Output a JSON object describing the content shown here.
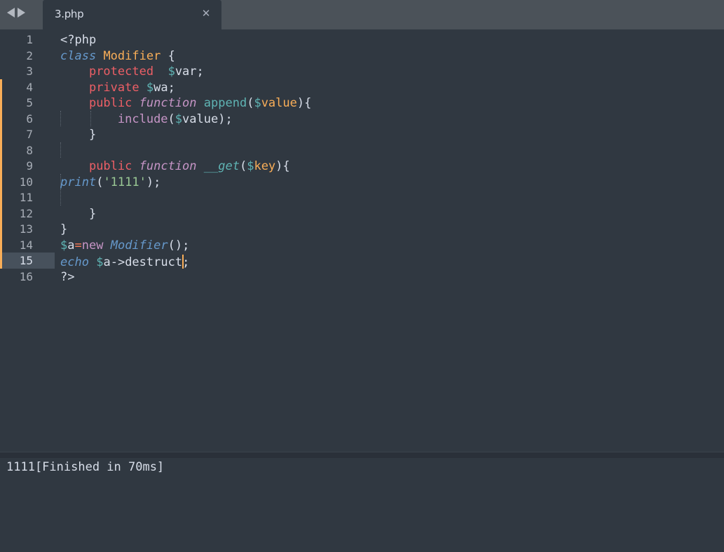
{
  "tab": {
    "title": "3.php",
    "close_icon": "close-icon"
  },
  "nav": {
    "back_icon": "triangle-left-icon",
    "forward_icon": "triangle-right-icon"
  },
  "editor": {
    "current_line": 15,
    "modified_lines": [
      4,
      5,
      6,
      7,
      8,
      9,
      10,
      11,
      12,
      13,
      14,
      15
    ],
    "lines": [
      {
        "num": "1",
        "tokens": [
          {
            "t": "<?php",
            "c": "plain"
          }
        ]
      },
      {
        "num": "2",
        "tokens": [
          {
            "t": "class",
            "c": "stor"
          },
          {
            "t": " ",
            "c": "plain"
          },
          {
            "t": "Modifier",
            "c": "cls"
          },
          {
            "t": " {",
            "c": "plain"
          }
        ]
      },
      {
        "num": "3",
        "tokens": [
          {
            "t": "    ",
            "c": "plain"
          },
          {
            "t": "protected",
            "c": "mod"
          },
          {
            "t": "  ",
            "c": "plain"
          },
          {
            "t": "$",
            "c": "var-d"
          },
          {
            "t": "var",
            "c": "var"
          },
          {
            "t": ";",
            "c": "plain"
          }
        ]
      },
      {
        "num": "4",
        "tokens": [
          {
            "t": "    ",
            "c": "plain"
          },
          {
            "t": "private",
            "c": "mod"
          },
          {
            "t": " ",
            "c": "plain"
          },
          {
            "t": "$",
            "c": "var-d"
          },
          {
            "t": "wa",
            "c": "var"
          },
          {
            "t": ";",
            "c": "plain"
          }
        ]
      },
      {
        "num": "5",
        "tokens": [
          {
            "t": "    ",
            "c": "plain"
          },
          {
            "t": "public",
            "c": "mod"
          },
          {
            "t": " ",
            "c": "plain"
          },
          {
            "t": "function",
            "c": "kw-ital"
          },
          {
            "t": " ",
            "c": "plain"
          },
          {
            "t": "append",
            "c": "fn"
          },
          {
            "t": "(",
            "c": "plain"
          },
          {
            "t": "$",
            "c": "var-d"
          },
          {
            "t": "value",
            "c": "param"
          },
          {
            "t": "){",
            "c": "plain"
          }
        ]
      },
      {
        "num": "6",
        "tokens": [
          {
            "t": "        ",
            "c": "plain"
          },
          {
            "t": "include",
            "c": "kw"
          },
          {
            "t": "(",
            "c": "plain"
          },
          {
            "t": "$",
            "c": "var-d"
          },
          {
            "t": "value",
            "c": "var"
          },
          {
            "t": ");",
            "c": "plain"
          }
        ]
      },
      {
        "num": "7",
        "tokens": [
          {
            "t": "    }",
            "c": "plain"
          }
        ]
      },
      {
        "num": "8",
        "tokens": []
      },
      {
        "num": "9",
        "tokens": [
          {
            "t": "    ",
            "c": "plain"
          },
          {
            "t": "public",
            "c": "mod"
          },
          {
            "t": " ",
            "c": "plain"
          },
          {
            "t": "function",
            "c": "kw-ital"
          },
          {
            "t": " ",
            "c": "plain"
          },
          {
            "t": "__get",
            "c": "fn-ital"
          },
          {
            "t": "(",
            "c": "plain"
          },
          {
            "t": "$",
            "c": "var-d"
          },
          {
            "t": "key",
            "c": "param"
          },
          {
            "t": "){",
            "c": "plain"
          }
        ]
      },
      {
        "num": "10",
        "tokens": [
          {
            "t": "print",
            "c": "ital"
          },
          {
            "t": "(",
            "c": "plain"
          },
          {
            "t": "'1111'",
            "c": "str"
          },
          {
            "t": ");",
            "c": "plain"
          }
        ]
      },
      {
        "num": "11",
        "tokens": []
      },
      {
        "num": "12",
        "tokens": [
          {
            "t": "    }",
            "c": "plain"
          }
        ]
      },
      {
        "num": "13",
        "tokens": [
          {
            "t": "}",
            "c": "plain"
          }
        ]
      },
      {
        "num": "14",
        "tokens": [
          {
            "t": "$",
            "c": "var-d"
          },
          {
            "t": "a",
            "c": "var"
          },
          {
            "t": "=",
            "c": "op"
          },
          {
            "t": "new",
            "c": "kw"
          },
          {
            "t": " ",
            "c": "plain"
          },
          {
            "t": "Modifier",
            "c": "ital"
          },
          {
            "t": "();",
            "c": "plain"
          }
        ]
      },
      {
        "num": "15",
        "tokens": [
          {
            "t": "echo",
            "c": "ital"
          },
          {
            "t": " ",
            "c": "plain"
          },
          {
            "t": "$",
            "c": "var-d"
          },
          {
            "t": "a",
            "c": "var"
          },
          {
            "t": "->",
            "c": "plain"
          },
          {
            "t": "destruct",
            "c": "plain"
          },
          {
            "t": "|",
            "c": "caret"
          },
          {
            "t": ";",
            "c": "plain"
          }
        ]
      },
      {
        "num": "16",
        "tokens": [
          {
            "t": "?>",
            "c": "plain"
          }
        ]
      }
    ]
  },
  "output": {
    "text": "1111[Finished in 70ms]"
  },
  "colors": {
    "background": "#303841",
    "tabbar": "#4b5259",
    "modified_marker": "#f9ae58",
    "caret": "#f9ae58"
  }
}
